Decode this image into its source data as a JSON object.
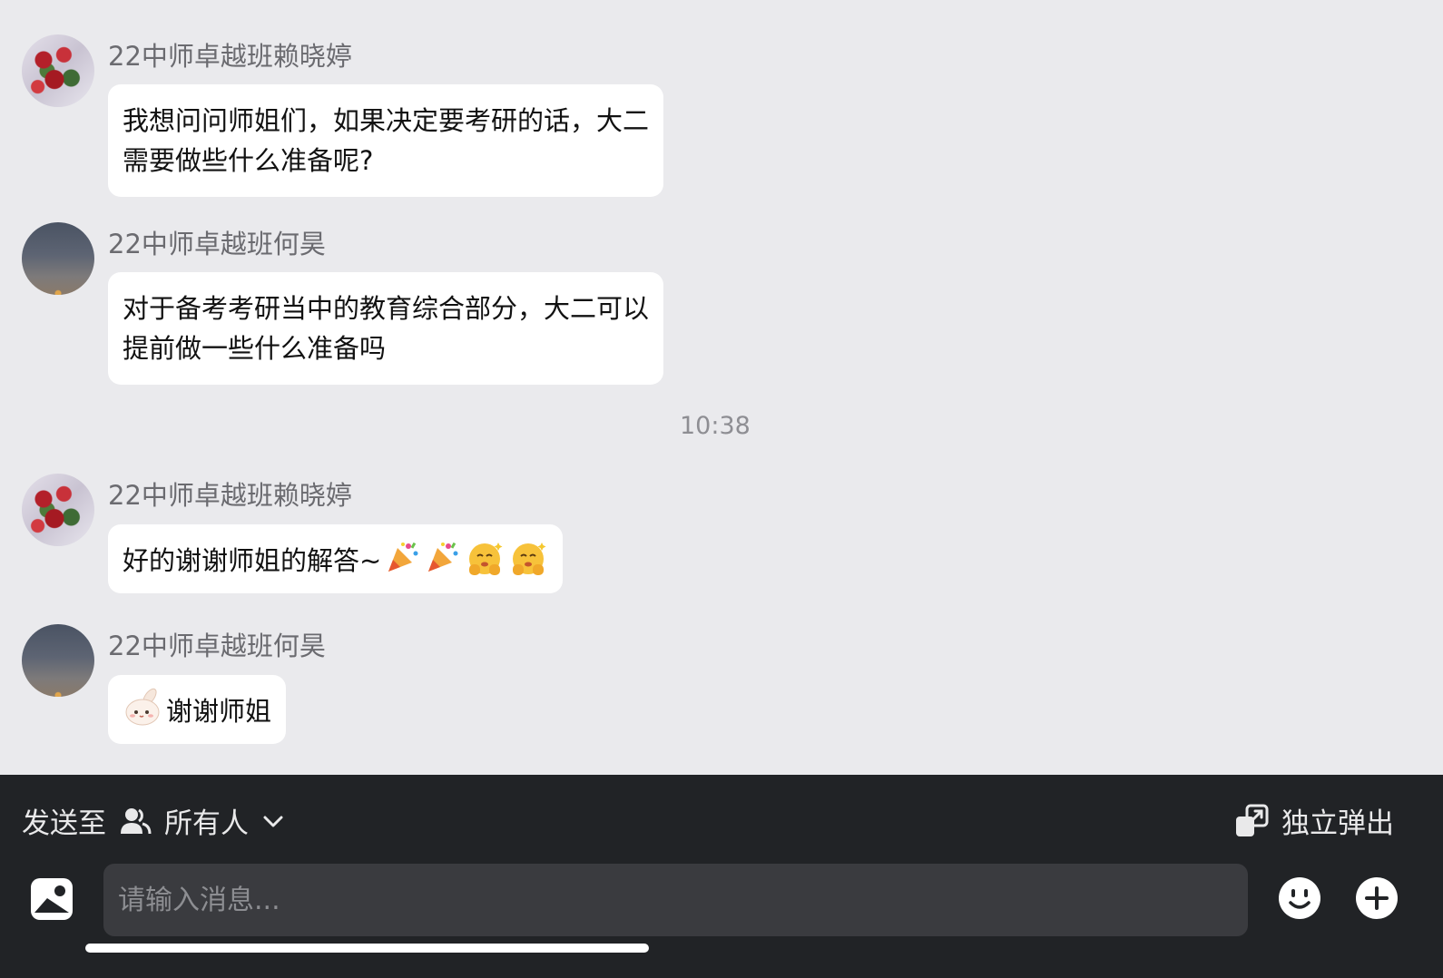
{
  "messages": [
    {
      "sender": "22中师卓越班赖晓婷",
      "avatar": "roses-photo",
      "lines": [
        "我想问问师姐们，如果决定要考研的话，大二",
        "需要做些什么准备呢?"
      ]
    },
    {
      "sender": "22中师卓越班何昊",
      "avatar": "sky-photo",
      "lines": [
        "对于备考考研当中的教育综合部分，大二可以",
        "提前做一些什么准备吗"
      ]
    },
    {
      "timestamp": "10:38"
    },
    {
      "sender": "22中师卓越班赖晓婷",
      "avatar": "roses-photo",
      "text": "好的谢谢师姐的解答~",
      "emojis": [
        "party-popper-icon",
        "party-popper-icon",
        "hugging-face-icon",
        "hugging-face-icon"
      ]
    },
    {
      "sender": "22中师卓越班何昊",
      "avatar": "sky-photo",
      "sticker": "bunny-sticker-icon",
      "text": "谢谢师姐"
    }
  ],
  "toolbar": {
    "send_to_label": "发送至",
    "recipient_icon": "people-icon",
    "recipient": "所有人",
    "popout_label": "独立弹出",
    "popout_icon": "popout-window-icon"
  },
  "composer": {
    "placeholder": "请输入消息...",
    "value": "",
    "left_icon": "image-icon",
    "right_icons": [
      "emoji-smile-icon",
      "plus-circle-icon"
    ]
  }
}
